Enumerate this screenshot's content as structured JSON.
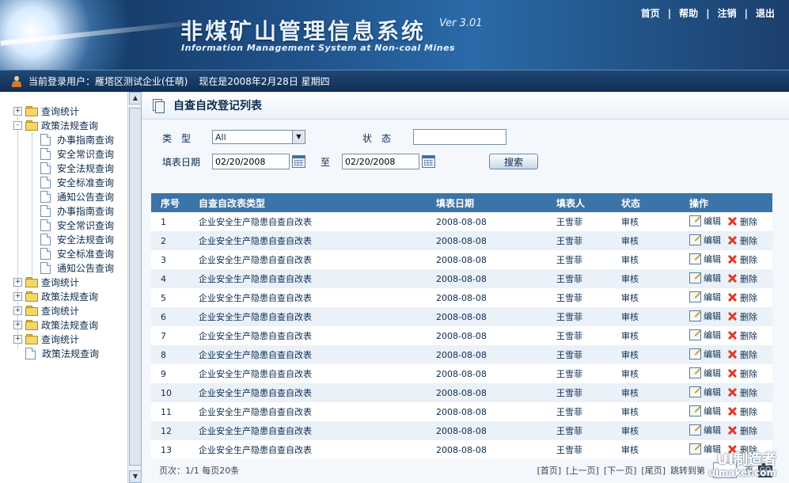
{
  "header": {
    "title_cn": "非煤矿山管理信息系统",
    "version": "Ver 3.01",
    "title_en": "Information Management System at Non-coal Mines",
    "nav": [
      "首页",
      "帮助",
      "注销",
      "退出"
    ],
    "nav_sep": "|"
  },
  "userbar": {
    "user_text": "当前登录用户：雁塔区测试企业(任萌)",
    "date_text": "现在是2008年2月28日  星期四"
  },
  "sidebar": {
    "items": [
      {
        "label": "查询统计",
        "type": "folder",
        "expand": "+"
      },
      {
        "label": "政策法规查询",
        "type": "folder",
        "expand": "-"
      },
      {
        "label": "办事指南查询",
        "type": "doc"
      },
      {
        "label": "安全常识查询",
        "type": "doc"
      },
      {
        "label": "安全法规查询",
        "type": "doc"
      },
      {
        "label": "安全标准查询",
        "type": "doc"
      },
      {
        "label": "通知公告查询",
        "type": "doc"
      },
      {
        "label": "办事指南查询",
        "type": "doc"
      },
      {
        "label": "安全常识查询",
        "type": "doc"
      },
      {
        "label": "安全法规查询",
        "type": "doc"
      },
      {
        "label": "安全标准查询",
        "type": "doc"
      },
      {
        "label": "通知公告查询",
        "type": "doc"
      },
      {
        "label": "查询统计",
        "type": "folder",
        "expand": "+"
      },
      {
        "label": "政策法规查询",
        "type": "folder",
        "expand": "+"
      },
      {
        "label": "查询统计",
        "type": "folder",
        "expand": "+"
      },
      {
        "label": "政策法规查询",
        "type": "folder",
        "expand": "+"
      },
      {
        "label": "查询统计",
        "type": "folder",
        "expand": "+"
      },
      {
        "label": "政策法规查询",
        "type": "doc-root"
      }
    ]
  },
  "page": {
    "title": "自查自改登记列表"
  },
  "search": {
    "type_label": "类　型",
    "type_value": "All",
    "status_label": "状　态",
    "status_value": "",
    "date_label": "填表日期",
    "date_from": "02/20/2008",
    "to_label": "至",
    "date_to": "02/20/2008",
    "search_button": "搜索"
  },
  "table": {
    "columns": [
      "序号",
      "自查自改表类型",
      "填表日期",
      "填表人",
      "状态",
      "操作"
    ],
    "edit_label": "编辑",
    "delete_label": "删除",
    "rows": [
      {
        "no": "1",
        "type": "企业安全生产隐患自查自改表",
        "date": "2008-08-08",
        "person": "王雪菲",
        "status": "审核"
      },
      {
        "no": "2",
        "type": "企业安全生产隐患自查自改表",
        "date": "2008-08-08",
        "person": "王雪菲",
        "status": "审核"
      },
      {
        "no": "3",
        "type": "企业安全生产隐患自查自改表",
        "date": "2008-08-08",
        "person": "王雪菲",
        "status": "审核"
      },
      {
        "no": "4",
        "type": "企业安全生产隐患自查自改表",
        "date": "2008-08-08",
        "person": "王雪菲",
        "status": "审核"
      },
      {
        "no": "5",
        "type": "企业安全生产隐患自查自改表",
        "date": "2008-08-08",
        "person": "王雪菲",
        "status": "审核"
      },
      {
        "no": "6",
        "type": "企业安全生产隐患自查自改表",
        "date": "2008-08-08",
        "person": "王雪菲",
        "status": "审核"
      },
      {
        "no": "7",
        "type": "企业安全生产隐患自查自改表",
        "date": "2008-08-08",
        "person": "王雪菲",
        "status": "审核"
      },
      {
        "no": "8",
        "type": "企业安全生产隐患自查自改表",
        "date": "2008-08-08",
        "person": "王雪菲",
        "status": "审核"
      },
      {
        "no": "9",
        "type": "企业安全生产隐患自查自改表",
        "date": "2008-08-08",
        "person": "王雪菲",
        "status": "审核"
      },
      {
        "no": "10",
        "type": "企业安全生产隐患自查自改表",
        "date": "2008-08-08",
        "person": "王雪菲",
        "status": "审核"
      },
      {
        "no": "11",
        "type": "企业安全生产隐患自查自改表",
        "date": "2008-08-08",
        "person": "王雪菲",
        "status": "审核"
      },
      {
        "no": "12",
        "type": "企业安全生产隐患自查自改表",
        "date": "2008-08-08",
        "person": "王雪菲",
        "status": "审核"
      },
      {
        "no": "13",
        "type": "企业安全生产隐患自查自改表",
        "date": "2008-08-08",
        "person": "王雪菲",
        "status": "审核"
      }
    ]
  },
  "pager": {
    "summary": "页次：1/1 每页20条",
    "first": "[首页]",
    "prev": "[上一页]",
    "next": "[下一页]",
    "last": "[尾页]",
    "jump_label": "跳转到第",
    "page_suffix": "页",
    "go": "GO"
  },
  "watermark": {
    "line1": "UI制造者",
    "line2": "uimaker.com"
  },
  "colors": {
    "header_dark": "#0f2f55",
    "table_header": "#3b74a8",
    "row_alt": "#eaf1f8",
    "delete_red": "#e23b2a"
  }
}
